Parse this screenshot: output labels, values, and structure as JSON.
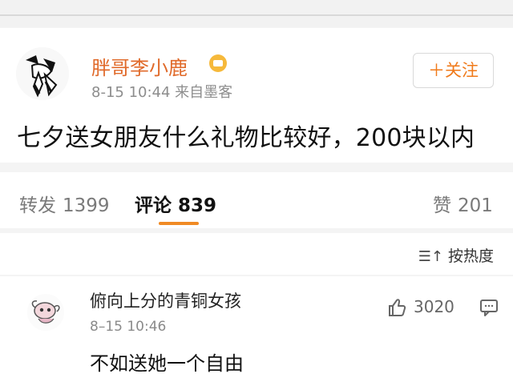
{
  "post": {
    "username": "胖哥李小鹿",
    "meta": "8-15 10:44  来自墨客",
    "follow_label": "＋关注",
    "text": "七夕送女朋友什么礼物比较好，200块以内"
  },
  "stats": {
    "repost_label": "转发",
    "repost_count": "1399",
    "comment_label": "评论",
    "comment_count": "839",
    "like_label": "赞",
    "like_count": "201"
  },
  "sort": {
    "label": "按热度"
  },
  "comment": {
    "username": "俯向上分的青铜女孩",
    "time": "8–15 10:46",
    "text": "不如送她一个自由",
    "likes": "3020"
  },
  "colors": {
    "accent": "#f08a24",
    "username": "#e06a2a",
    "follow": "#f07a1a"
  },
  "icons": {
    "verified": "verified-badge-icon",
    "sort": "sort-icon",
    "like": "thumbs-up-icon",
    "reply": "comment-reply-icon"
  }
}
